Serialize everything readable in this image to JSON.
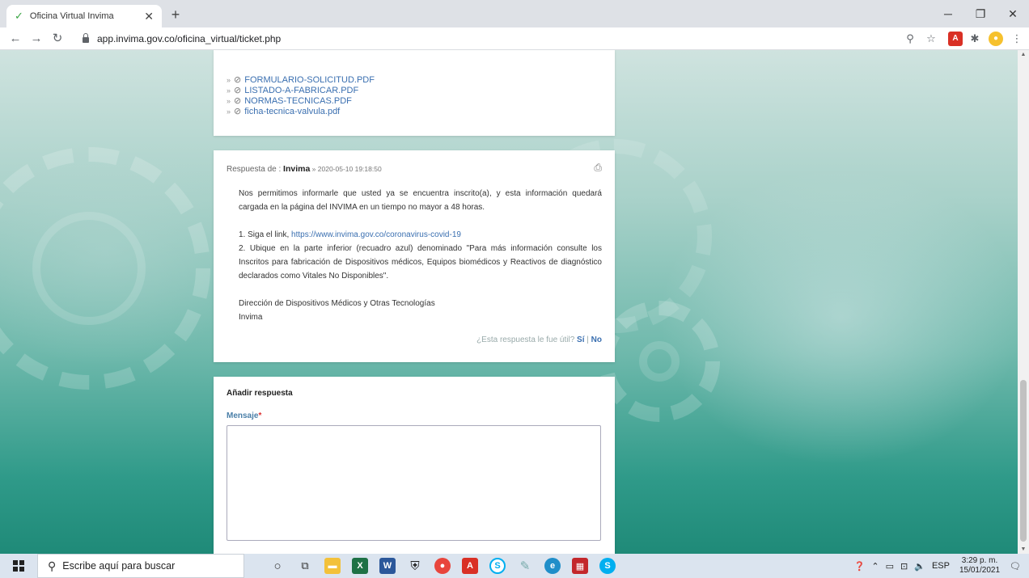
{
  "browser": {
    "tab_title": "Oficina Virtual Invima",
    "tab_favicon": "✓",
    "new_tab": "+",
    "url": "app.invima.gov.co/oficina_virtual/ticket.php"
  },
  "attachments": [
    {
      "name": "FORMULARIO-SOLICITUD.PDF"
    },
    {
      "name": "LISTADO-A-FABRICAR.PDF"
    },
    {
      "name": "NORMAS-TECNICAS.PDF"
    },
    {
      "name": "ficha-tecnica-valvula.pdf"
    }
  ],
  "response": {
    "prefix": "Respuesta de : ",
    "author": "Invima",
    "separator": " » ",
    "date": "2020-05-10 19:18:50",
    "para1": "Nos permitimos informarle que usted ya se encuentra inscrito(a), y esta información quedará cargada en la página del INVIMA en un tiempo no mayor a 48 horas.",
    "step1_prefix": "1. Siga el link, ",
    "step1_link": "https://www.invima.gov.co/coronavirus-covid-19",
    "step2": "2. Ubique en la parte inferior (recuadro azul) denominado \"Para más información consulte los Inscritos para fabricación de Dispositivos médicos, Equipos biomédicos y Reactivos de diagnóstico declarados como Vitales No Disponibles\".",
    "signature1": "Dirección de Dispositivos Médicos y Otras Tecnologías",
    "signature2": "Invima",
    "feedback_question": "¿Esta respuesta le fue útil?",
    "feedback_yes": "Sí",
    "feedback_sep": " | ",
    "feedback_no": "No"
  },
  "reply": {
    "title": "Añadir respuesta",
    "message_label": "Mensaje",
    "required_mark": "*"
  },
  "taskbar": {
    "search_placeholder": "Escribe aquí para buscar",
    "language": "ESP",
    "time": "3:29 p. m.",
    "date": "15/01/2021"
  },
  "colors": {
    "link": "#3a6fb0",
    "label_blue": "#4a7fa8",
    "required": "#d33333",
    "background_teal": "#2f9a89"
  }
}
